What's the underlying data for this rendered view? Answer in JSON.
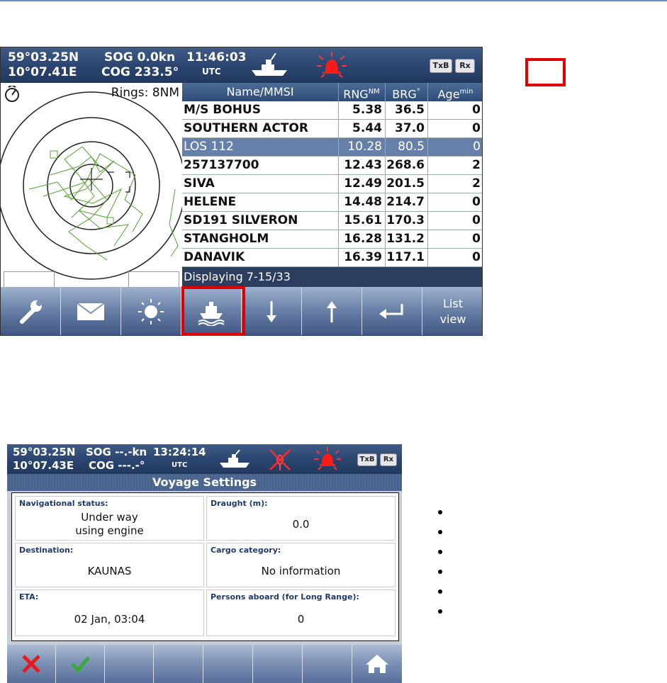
{
  "screen1": {
    "header": {
      "lat": "59°03.25N",
      "lon": "10°07.41E",
      "sog": "SOG 0.0kn",
      "cog": "COG 233.5°",
      "time": "11:46:03",
      "tz": "UTC",
      "chip_txb": "TxB",
      "chip_rx": "Rx"
    },
    "radar": {
      "rings_label": "Rings: 8NM",
      "zoom_out": "−",
      "zoom_in": "+"
    },
    "table": {
      "columns": [
        "Name/MMSI",
        "RNG",
        "NM",
        "BRG",
        "°",
        "Age",
        "min"
      ],
      "rows": [
        {
          "name": "M/S BOHUS",
          "rng": "5.38",
          "brg": "36.5",
          "age": "0"
        },
        {
          "name": "SOUTHERN ACTOR",
          "rng": "5.44",
          "brg": "37.0",
          "age": "0"
        },
        {
          "name": "LOS 112",
          "rng": "10.28",
          "brg": "80.5",
          "age": "0"
        },
        {
          "name": "257137700",
          "rng": "12.43",
          "brg": "268.6",
          "age": "2"
        },
        {
          "name": "SIVA",
          "rng": "12.49",
          "brg": "201.5",
          "age": "2"
        },
        {
          "name": "HELENE",
          "rng": "14.48",
          "brg": "214.7",
          "age": "0"
        },
        {
          "name": "SD191 SILVERON",
          "rng": "15.61",
          "brg": "170.3",
          "age": "0"
        },
        {
          "name": "STANGHOLM",
          "rng": "16.28",
          "brg": "131.2",
          "age": "0"
        },
        {
          "name": "DANAVIK",
          "rng": "16.39",
          "brg": "117.1",
          "age": "0"
        }
      ],
      "selected_index": 2
    },
    "status": "Displaying 7-15/33",
    "toolbar": {
      "list_view": "List\nview"
    }
  },
  "screen2": {
    "header": {
      "lat": "59°03.25N",
      "lon": "10°07.43E",
      "sog": "SOG --.-kn",
      "cog": "COG ---.-°",
      "time": "13:24:14",
      "tz": "UTC",
      "chip_txb": "TxB",
      "chip_rx": "Rx"
    },
    "title": "Voyage Settings",
    "fields": {
      "nav_status_label": "Navigational status:",
      "nav_status_line1": "Under way",
      "nav_status_line2": "using engine",
      "draught_label": "Draught (m):",
      "draught_value": "0.0",
      "destination_label": "Destination:",
      "destination_value": "KAUNAS",
      "cargo_label": "Cargo category:",
      "cargo_value": "No information",
      "eta_label": "ETA:",
      "eta_value": "02 Jan, 03:04",
      "persons_label": "Persons aboard (for Long Range):",
      "persons_value": "0"
    }
  },
  "colors": {
    "highlight_red": "#e10000",
    "header_blue": "#2a446e",
    "selected_row": "#6680aa"
  }
}
